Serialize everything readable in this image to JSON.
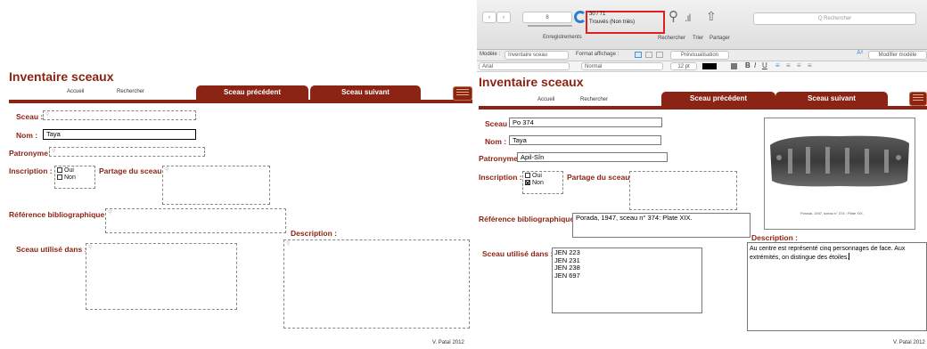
{
  "left": {
    "title": "Inventaire sceaux",
    "nav": {
      "accueil": "Accueil",
      "rechercher": "Rechercher"
    },
    "tabs": {
      "prev": "Sceau précédent",
      "next": "Sceau suivant"
    },
    "labels": {
      "sceau": "Sceau :",
      "nom": "Nom :",
      "patronyme": "Patronyme :",
      "inscription": "Inscription :",
      "partage": "Partage du sceau",
      "reference": "Référence bibliographique :",
      "description": "Description :",
      "utilise": "Sceau utilisé dans :"
    },
    "values": {
      "nom": "Taya"
    },
    "options": {
      "oui": "Oui",
      "non": "Non"
    },
    "credit": "V. Pataï 2012"
  },
  "toolbar": {
    "stepper_value": "8",
    "records_label": "Enregistrements",
    "records_count": "30 / 71",
    "records_status": "Trouvés (Non triés)",
    "rechercher": "Rechercher",
    "trier": "Trier",
    "partager": "Partager",
    "search_placeholder": "Q Rechercher",
    "modele_label": "Modèle :",
    "modele_value": "Inventaire sceau",
    "format_label": "Format affichage :",
    "preview": "Prévisualisation",
    "modify": "Modifier modèle",
    "font": "Arial",
    "style": "Normal",
    "size": "12 pt",
    "bold": "B",
    "italic": "I",
    "underline": "U"
  },
  "right": {
    "title": "Inventaire sceaux",
    "nav": {
      "accueil": "Accueil",
      "rechercher": "Rechercher"
    },
    "tabs": {
      "prev": "Sceau précédent",
      "next": "Sceau suivant"
    },
    "labels": {
      "sceau": "Sceau :",
      "nom": "Nom :",
      "patronyme": "Patronyme :",
      "inscription": "Inscription :",
      "partage": "Partage du sceau",
      "reference": "Référence bibliographique :",
      "description": "Description :",
      "utilise": "Sceau utilisé dans :"
    },
    "values": {
      "sceau": "Po 374",
      "nom": "Taya",
      "patronyme": "Apil-Sîn",
      "reference": "Porada, 1947, sceau n° 374: Plate XIX.",
      "utilise": [
        "JEN 223",
        "JEN 231",
        "JEN 238",
        "JEN 697"
      ],
      "description": "Au centre est représenté cinq personnages de face. Aux extrémités, on distingue des étoiles.",
      "image_caption": "Porada, 1947, sceau n° 374 : Plate XIX."
    },
    "options": {
      "oui": "Oui",
      "non": "Non"
    },
    "credit": "V. Pataï 2012"
  },
  "colors": {
    "accent": "#8b2414",
    "highlight": "#e02020"
  }
}
